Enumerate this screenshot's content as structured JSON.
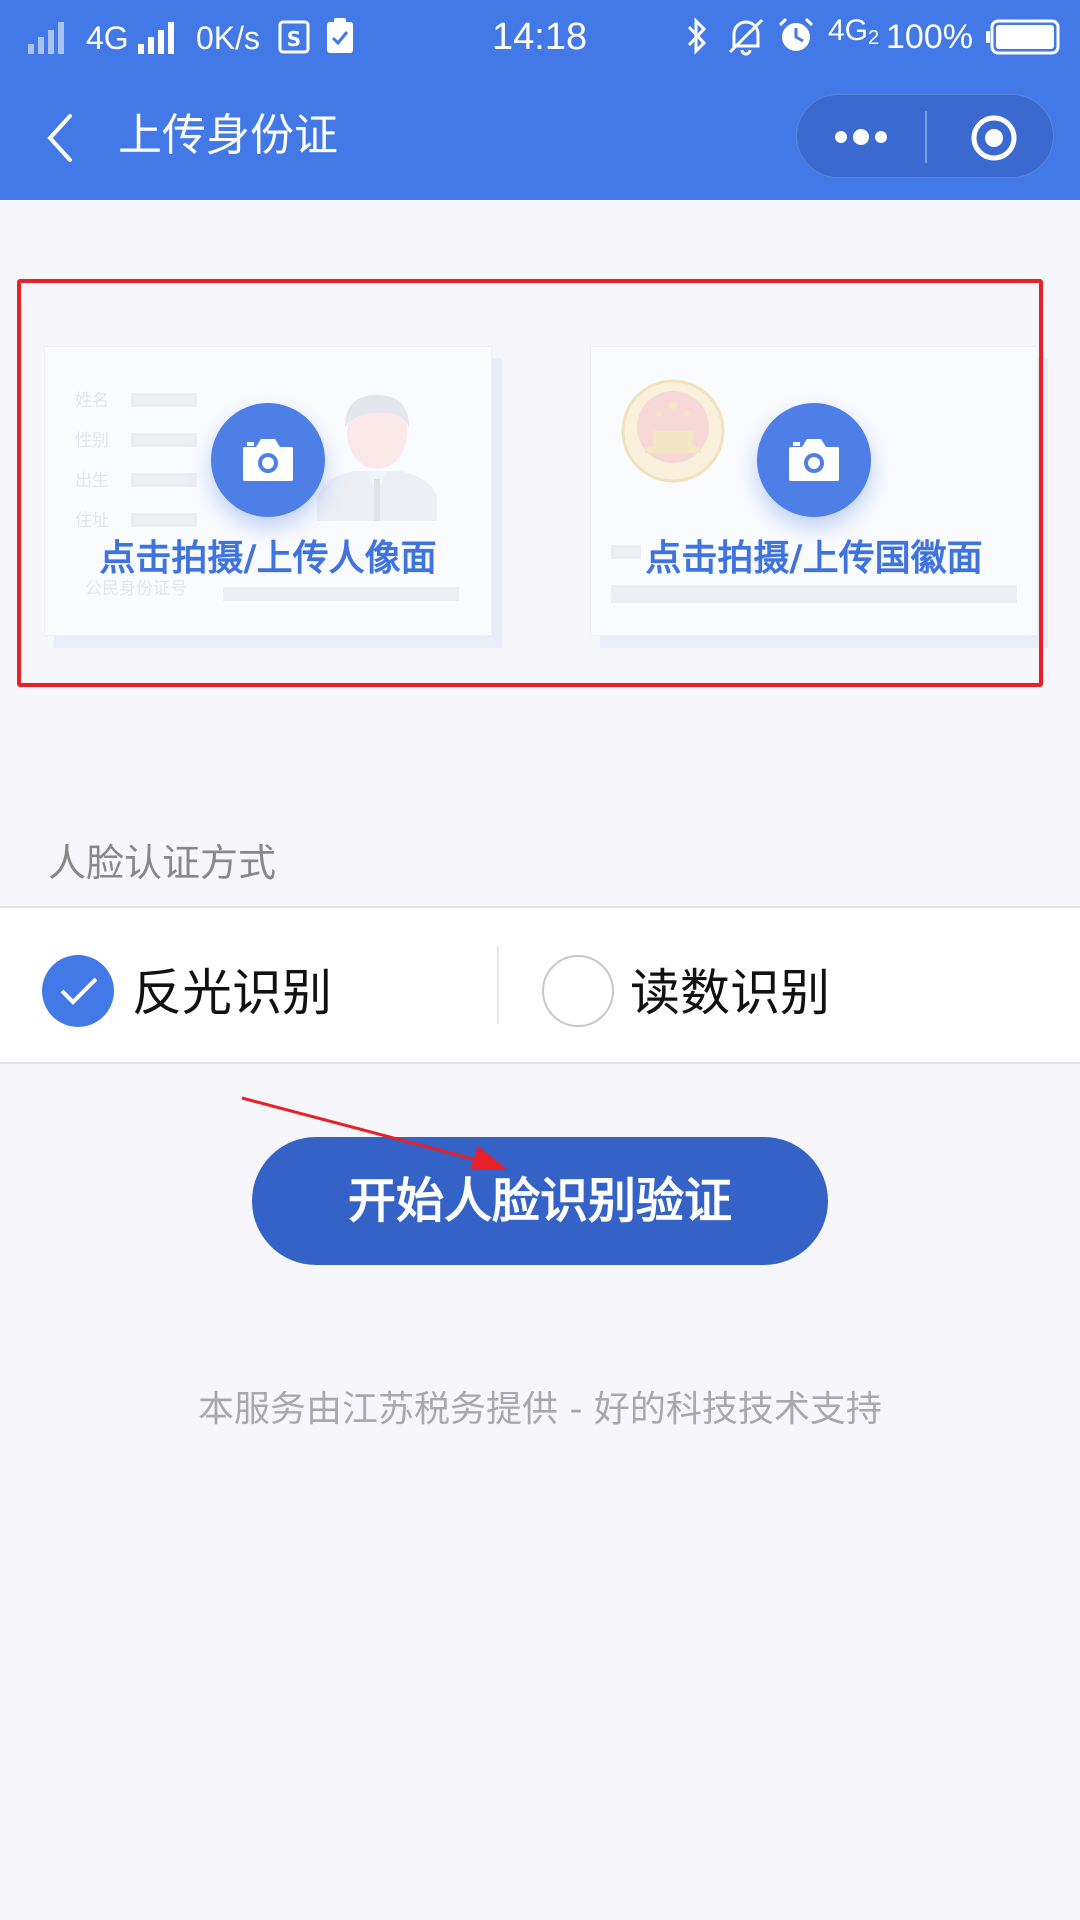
{
  "status_bar": {
    "network_type": "4G",
    "speed": "0K/s",
    "time": "14:18",
    "network_type_2": "4G",
    "sim_index": "2",
    "battery": "100%"
  },
  "nav": {
    "title": "上传身份证"
  },
  "id_cards": {
    "front": {
      "label": "点击拍摄/上传人像面",
      "fields": [
        "姓名",
        "性别",
        "出生",
        "住址",
        "公民身份证号"
      ]
    },
    "back": {
      "label": "点击拍摄/上传国徽面"
    }
  },
  "face_auth": {
    "section_label": "人脸认证方式",
    "options": [
      {
        "label": "反光识别",
        "checked": true
      },
      {
        "label": "读数识别",
        "checked": false
      }
    ]
  },
  "start_button": {
    "label": "开始人脸识别验证"
  },
  "footer": {
    "note": "本服务由江苏税务提供 - 好的科技技术支持"
  },
  "colors": {
    "primary": "#4379e6",
    "button": "#3562c7",
    "annotation_red": "#e8202a"
  }
}
